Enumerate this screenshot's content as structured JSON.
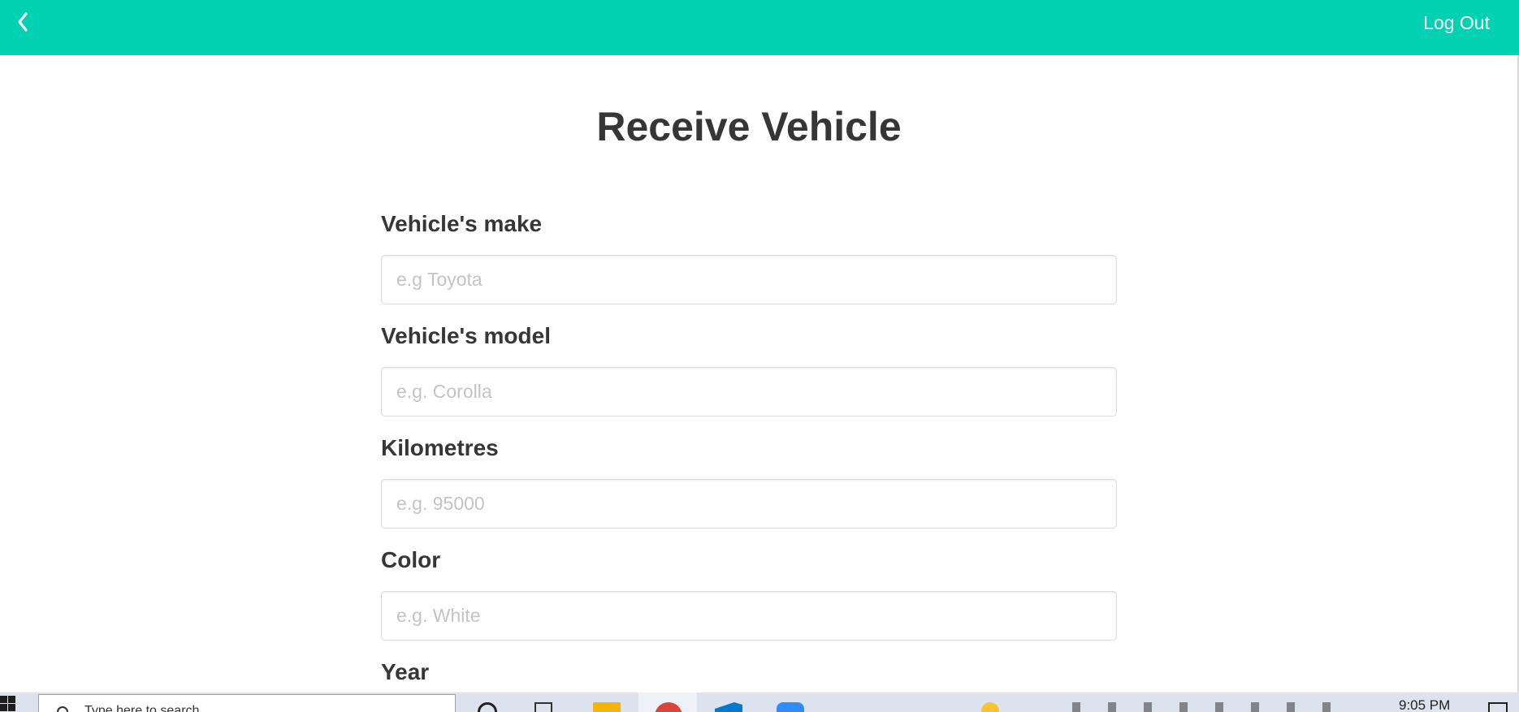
{
  "header": {
    "back_icon": "chevron-left-icon",
    "logout_label": "Log Out",
    "brand_color": "#00d1b2"
  },
  "page": {
    "title": "Receive Vehicle"
  },
  "form": {
    "fields": [
      {
        "label": "Vehicle's make",
        "placeholder": "e.g Toyota",
        "value": ""
      },
      {
        "label": "Vehicle's model",
        "placeholder": "e.g. Corolla",
        "value": ""
      },
      {
        "label": "Kilometres",
        "placeholder": "e.g. 95000",
        "value": ""
      },
      {
        "label": "Color",
        "placeholder": "e.g. White",
        "value": ""
      },
      {
        "label": "Year"
      }
    ]
  },
  "taskbar": {
    "search_text": "Type here to search",
    "clock": "9:05 PM",
    "icons": [
      "windows-start-icon",
      "search-icon",
      "cortana-icon",
      "task-view-icon",
      "file-explorer-icon",
      "chrome-icon",
      "vscode-icon",
      "zoom-icon",
      "weather-icon",
      "system-tray-icons",
      "notification-icon"
    ]
  }
}
